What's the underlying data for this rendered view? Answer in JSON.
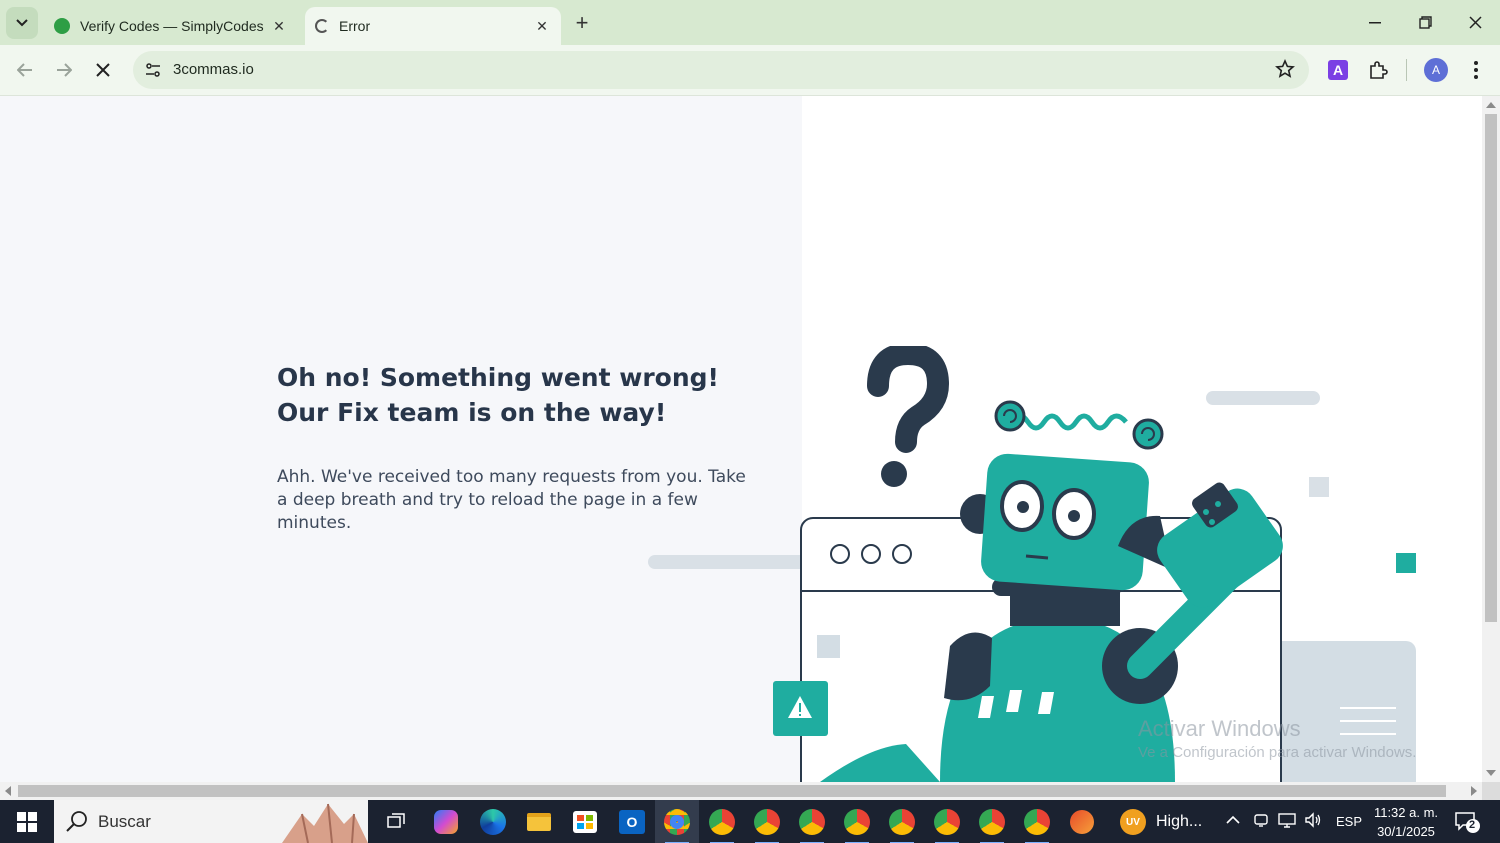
{
  "browser": {
    "tabs": [
      {
        "title": "Verify Codes — SimplyCodes",
        "active": false
      },
      {
        "title": "Error",
        "active": true
      }
    ],
    "url": "3commas.io",
    "profile_initial": "A",
    "extension_letter": "A"
  },
  "page": {
    "heading_line1": "Oh no! Something went wrong!",
    "heading_line2": "Our Fix team is on the way!",
    "message": "Ahh. We've received too many requests from you. Take a deep breath and try to reload the page in a few minutes.",
    "accent_color": "#1fada0",
    "dark_color": "#2a3a4c"
  },
  "watermark": {
    "line1": "Activar Windows",
    "line2": "Ve a Configuración para activar Windows."
  },
  "taskbar": {
    "search_placeholder": "Buscar",
    "weather_badge": "UV",
    "weather_label": "High...",
    "language": "ESP",
    "time": "11:32 a. m.",
    "date": "30/1/2025",
    "notification_count": "2"
  }
}
